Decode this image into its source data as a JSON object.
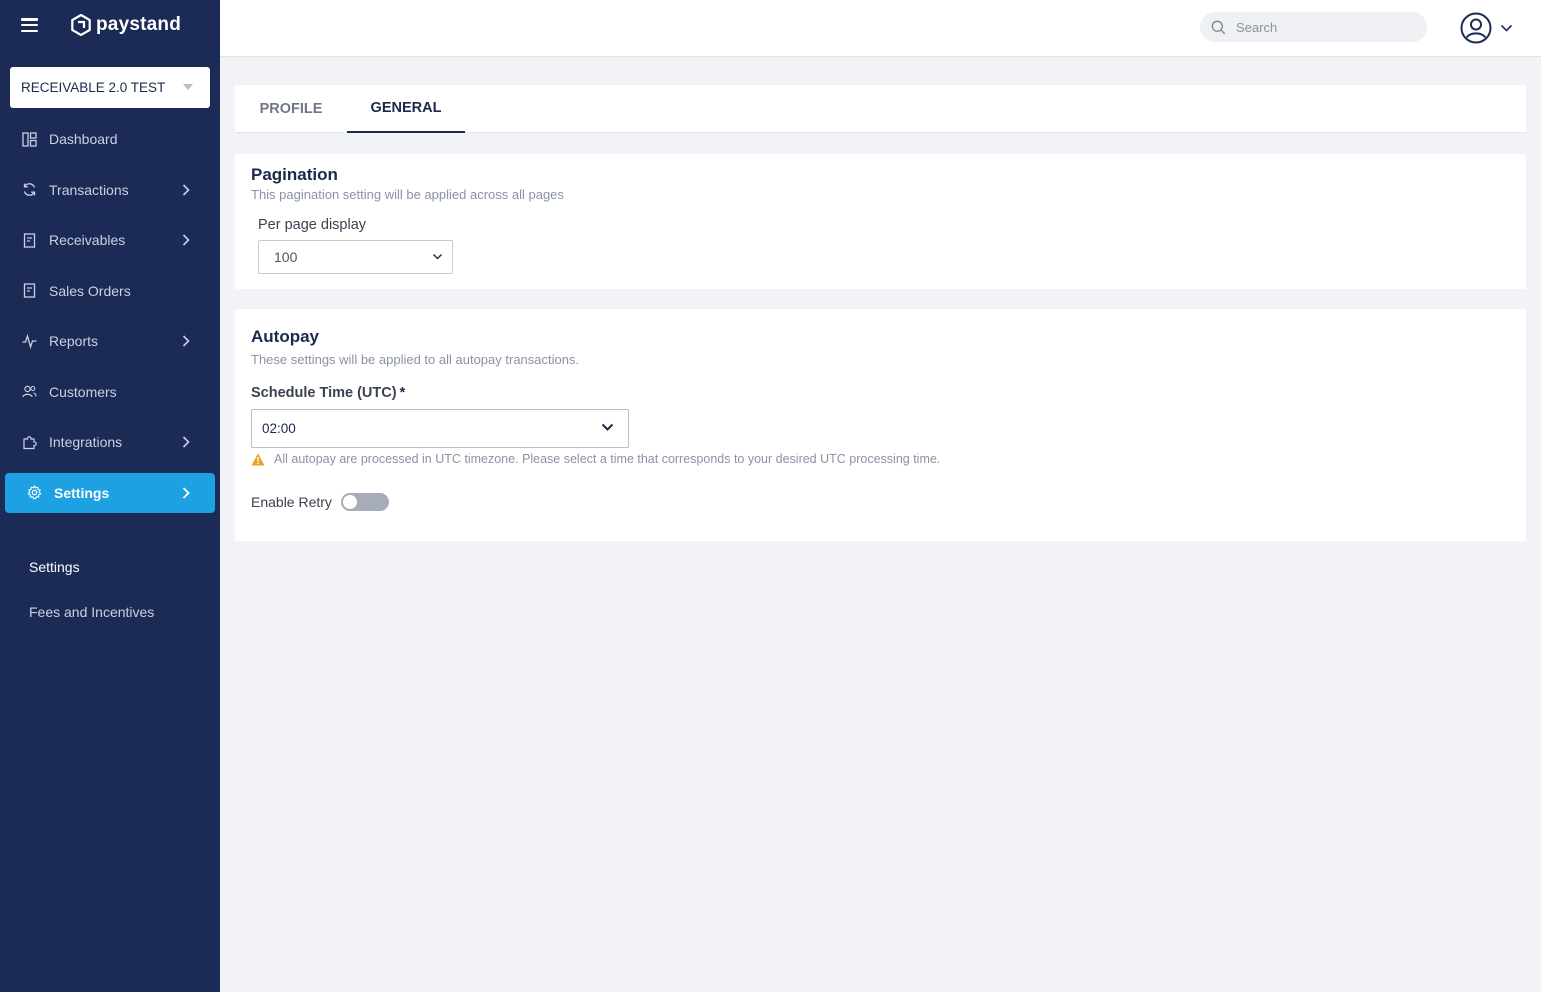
{
  "brand": {
    "name": "paystand"
  },
  "account": {
    "selected": "RECEIVABLE 2.0 TEST"
  },
  "sidebar": {
    "items": [
      {
        "label": "Dashboard",
        "icon": "dashboard-icon"
      },
      {
        "label": "Transactions",
        "icon": "refresh-icon"
      },
      {
        "label": "Receivables",
        "icon": "document-icon"
      },
      {
        "label": "Sales Orders",
        "icon": "document-icon"
      },
      {
        "label": "Reports",
        "icon": "activity-icon"
      },
      {
        "label": "Customers",
        "icon": "users-icon"
      },
      {
        "label": "Integrations",
        "icon": "puzzle-icon"
      },
      {
        "label": "Settings",
        "icon": "gear-icon"
      }
    ],
    "subitems": [
      {
        "label": "Settings"
      },
      {
        "label": "Fees and Incentives"
      }
    ]
  },
  "header": {
    "search_placeholder": "Search"
  },
  "tabs": [
    {
      "label": "PROFILE"
    },
    {
      "label": "GENERAL"
    }
  ],
  "pagination": {
    "title": "Pagination",
    "subtitle": "This pagination setting will be applied across all pages",
    "per_page_label": "Per page display",
    "per_page_value": "100"
  },
  "autopay": {
    "title": "Autopay",
    "subtitle": "These settings will be applied to all autopay transactions.",
    "schedule_label": "Schedule Time (UTC)",
    "required_mark": "*",
    "schedule_value": "02:00",
    "warning": "All autopay are processed in UTC timezone. Please select a time that corresponds to your desired UTC processing time.",
    "retry_label": "Enable Retry",
    "retry_enabled": false
  },
  "colors": {
    "sidebar_bg": "#1b2b55",
    "active_nav": "#1da1e2",
    "warning": "#f0a020"
  }
}
